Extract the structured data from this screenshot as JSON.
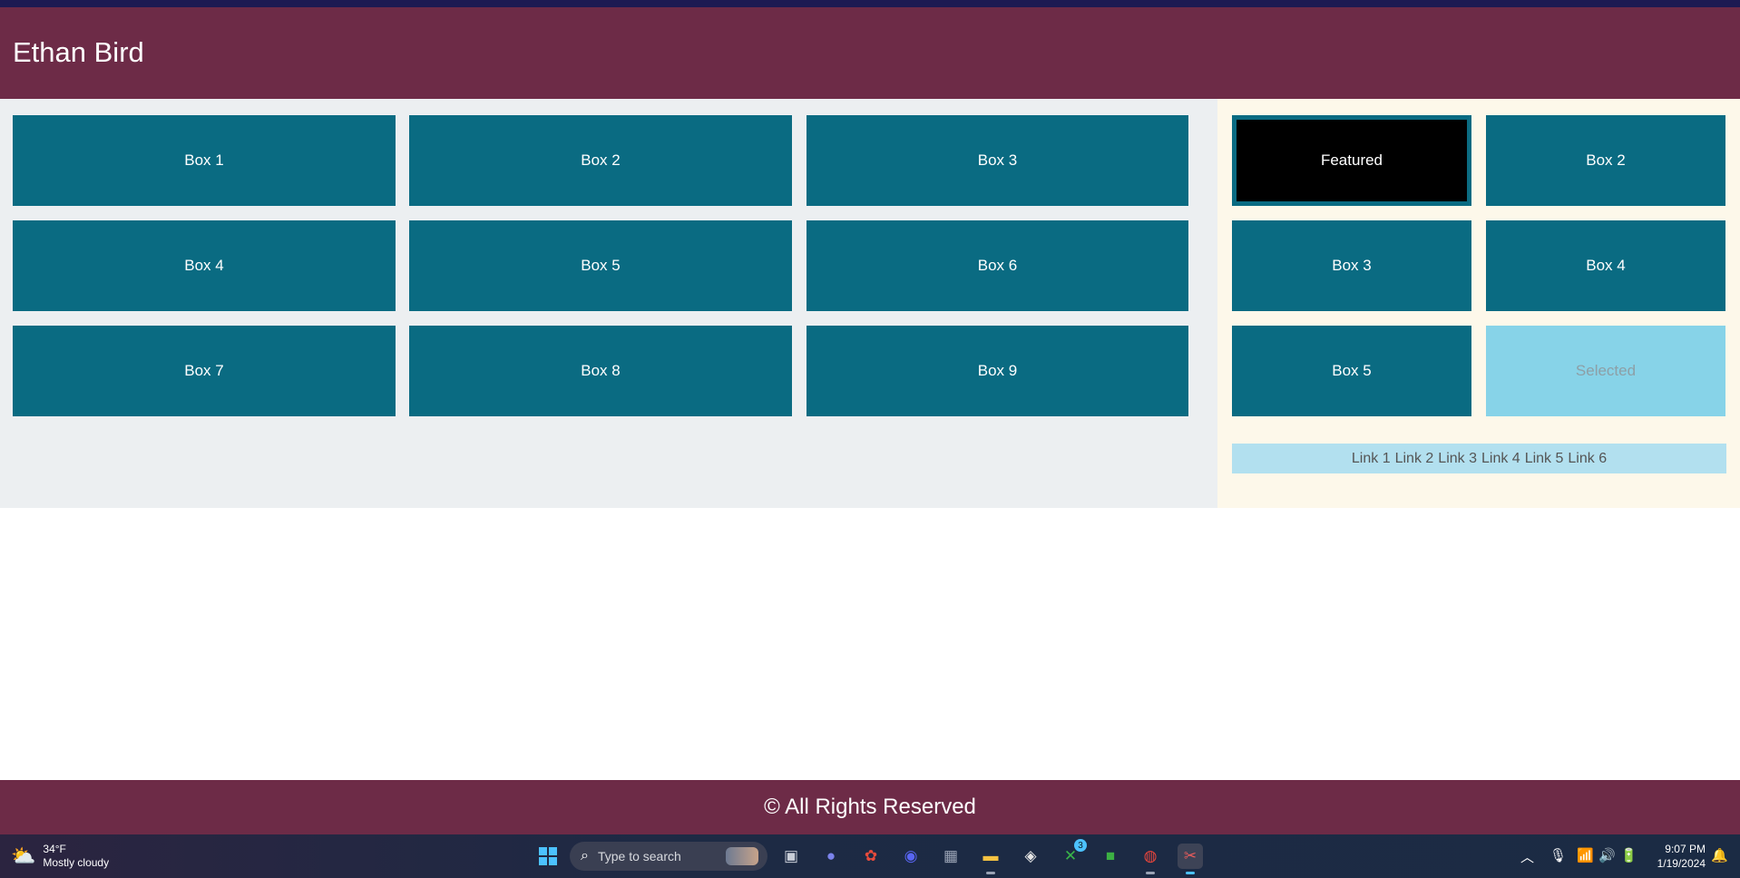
{
  "header": {
    "title": "Ethan Bird"
  },
  "main": {
    "boxes": [
      "Box 1",
      "Box 2",
      "Box 3",
      "Box 4",
      "Box 5",
      "Box 6",
      "Box 7",
      "Box 8",
      "Box 9"
    ]
  },
  "aside": {
    "tiles": [
      "Featured",
      "Box 2",
      "Box 3",
      "Box 4",
      "Box 5",
      "Selected"
    ],
    "links": [
      "Link 1",
      "Link 2",
      "Link 3",
      "Link 4",
      "Link 5",
      "Link 6"
    ]
  },
  "footer": {
    "text": "© All Rights Reserved"
  },
  "colors": {
    "header_bg": "#6d2b47",
    "box_bg": "#0a6b82",
    "featured_bg": "#000000",
    "selected_bg": "#87d3e8",
    "main_bg": "#eceff1",
    "aside_bg": "#fdf8ea",
    "links_bg": "#b2e0ef"
  },
  "taskbar": {
    "weather": {
      "temp": "34°F",
      "condition": "Mostly cloudy"
    },
    "search_placeholder": "Type to search",
    "xbox_badge": "3",
    "time": "9:07 PM",
    "date": "1/19/2024",
    "icons": [
      "windows-start-icon",
      "search-icon",
      "task-view-icon",
      "teams-icon",
      "color-wheel-icon",
      "discord-icon",
      "calculator-icon",
      "file-explorer-icon",
      "book-icon",
      "xbox-icon",
      "minecraft-icon",
      "chrome-icon",
      "snipping-tool-icon",
      "chevron-up-icon",
      "microphone-icon",
      "wifi-icon",
      "volume-icon",
      "battery-icon",
      "notification-icon"
    ]
  }
}
